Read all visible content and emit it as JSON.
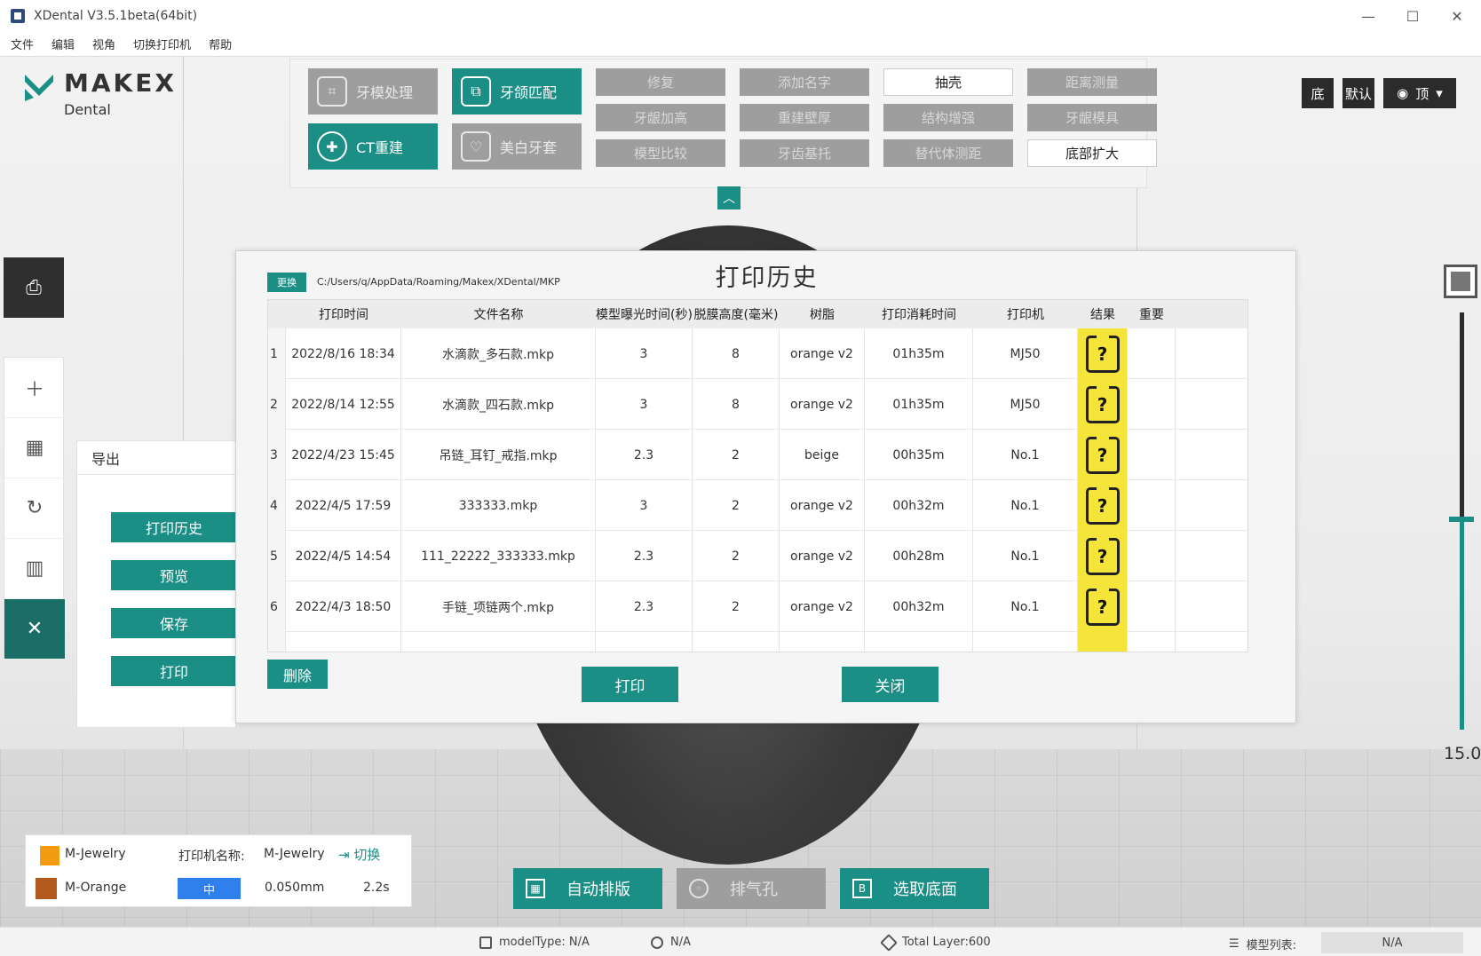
{
  "window": {
    "title": "XDental V3.5.1beta(64bit)",
    "minimize": "—",
    "maximize": "☐",
    "close": "✕"
  },
  "menu": [
    "文件",
    "编辑",
    "视角",
    "切换打印机",
    "帮助"
  ],
  "logo": {
    "brand": "MAKEX",
    "sub": "Dental"
  },
  "tools": {
    "big": [
      {
        "label": "牙模处理",
        "style": "gray",
        "icon": "tooth-frame-icon"
      },
      {
        "label": "牙颌匹配",
        "style": "teal",
        "icon": "jaw-match-icon"
      },
      {
        "label": "CT重建",
        "style": "teal",
        "icon": "ct-icon"
      },
      {
        "label": "美白牙套",
        "style": "gray",
        "icon": "tooth-icon"
      }
    ],
    "small": [
      [
        "修复",
        "添加名字",
        "抽壳",
        "距离测量"
      ],
      [
        "牙龈加高",
        "重建壁厚",
        "结构增强",
        "牙龈模具"
      ],
      [
        "模型比较",
        "牙齿基托",
        "替代体测距",
        "底部扩大"
      ]
    ],
    "small_white": [
      "抽壳",
      "底部扩大"
    ]
  },
  "view": {
    "bottom": "底",
    "default": "默认",
    "top": "顶"
  },
  "export": {
    "header": "导出",
    "buttons": [
      "打印历史",
      "预览",
      "保存",
      "打印"
    ]
  },
  "layer": {
    "value": "15.0"
  },
  "dialog": {
    "title": "打印历史",
    "change": "更换",
    "path": "C:/Users/q/AppData/Roaming/Makex/XDental/MKP",
    "columns": [
      "打印时间",
      "文件名称",
      "模型曝光时间(秒)",
      "脱膜高度(毫米)",
      "树脂",
      "打印消耗时间",
      "打印机",
      "结果",
      "重要"
    ],
    "rows": [
      {
        "idx": "1",
        "time": "2022/8/16 18:34",
        "file": "水滴款_多石款.mkp",
        "exposure": "3",
        "lift": "8",
        "resin": "orange v2",
        "duration": "01h35m",
        "printer": "MJ50",
        "result": "?"
      },
      {
        "idx": "2",
        "time": "2022/8/14 12:55",
        "file": "水滴款_四石款.mkp",
        "exposure": "3",
        "lift": "8",
        "resin": "orange v2",
        "duration": "01h35m",
        "printer": "MJ50",
        "result": "?"
      },
      {
        "idx": "3",
        "time": "2022/4/23 15:45",
        "file": "吊链_耳钉_戒指.mkp",
        "exposure": "2.3",
        "lift": "2",
        "resin": "beige",
        "duration": "00h35m",
        "printer": "No.1",
        "result": "?"
      },
      {
        "idx": "4",
        "time": "2022/4/5 17:59",
        "file": "333333.mkp",
        "exposure": "3",
        "lift": "2",
        "resin": "orange v2",
        "duration": "00h32m",
        "printer": "No.1",
        "result": "?"
      },
      {
        "idx": "5",
        "time": "2022/4/5 14:54",
        "file": "111_22222_333333.mkp",
        "exposure": "2.3",
        "lift": "2",
        "resin": "orange v2",
        "duration": "00h28m",
        "printer": "No.1",
        "result": "?"
      },
      {
        "idx": "6",
        "time": "2022/4/3 18:50",
        "file": "手链_项链两个.mkp",
        "exposure": "2.3",
        "lift": "2",
        "resin": "orange v2",
        "duration": "00h32m",
        "printer": "No.1",
        "result": "?"
      }
    ],
    "delete": "删除",
    "print": "打印",
    "close": "关闭"
  },
  "printer": {
    "name1": "M-Jewelry",
    "label": "打印机名称:",
    "value": "M-Jewelry",
    "switch": "切换",
    "name2": "M-Orange",
    "speed": "中",
    "layer": "0.050mm",
    "time": "2.2s",
    "color1": "#f39c12",
    "color2": "#b35a1f"
  },
  "bottom": {
    "auto": "自动排版",
    "vent": "排气孔",
    "base": "选取底面"
  },
  "status": {
    "modelType": "modelType: N/A",
    "na": "N/A",
    "totalLayer": "Total Layer:600",
    "modelList": "模型列表:",
    "modelListValue": "N/A"
  },
  "colors": {
    "accent": "#1b8f86",
    "gray": "#9e9e9e",
    "result": "#f5e43a"
  }
}
